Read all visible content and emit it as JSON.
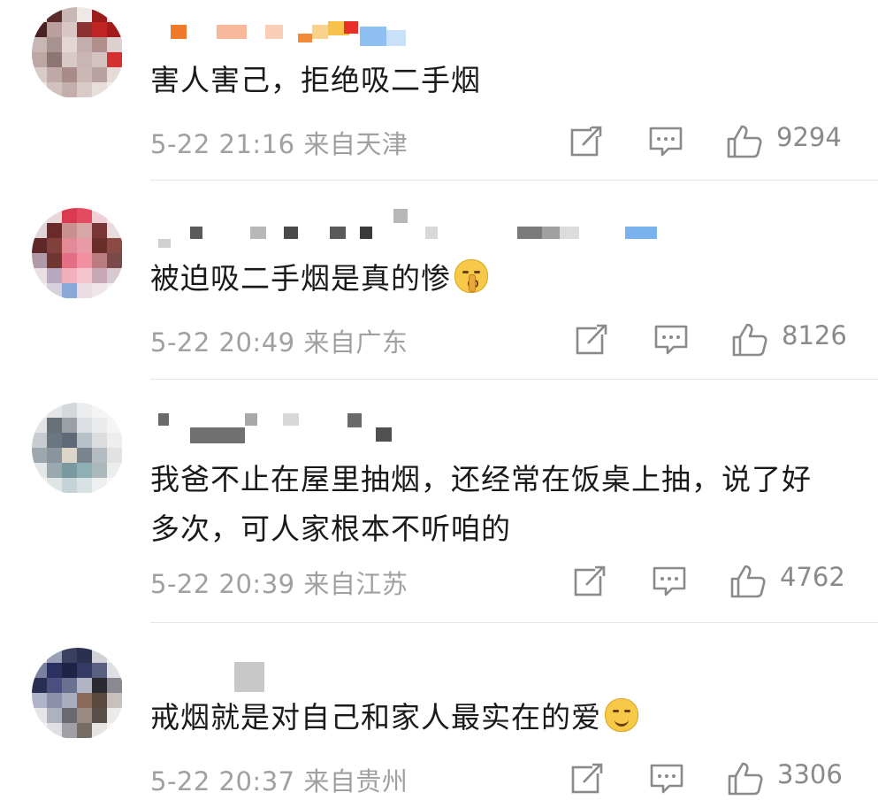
{
  "comments": [
    {
      "text": "害人害己，拒绝吸二手烟",
      "timestamp": "5-22 21:16",
      "location": "来自天津",
      "likes": "9294",
      "emoji": null
    },
    {
      "text": "被迫吸二手烟是真的惨",
      "timestamp": "5-22 20:49",
      "location": "来自广东",
      "likes": "8126",
      "emoji": "shushing-face-emoji"
    },
    {
      "text": "我爸不止在屋里抽烟，还经常在饭桌上抽，说了好多次，可人家根本不听咱的",
      "timestamp": "5-22 20:39",
      "location": "来自江苏",
      "likes": "4762",
      "emoji": null
    },
    {
      "text": "戒烟就是对自己和家人最实在的爱",
      "timestamp": "5-22 20:37",
      "location": "来自贵州",
      "likes": "3306",
      "emoji": "smiling-face-emoji"
    }
  ],
  "icons": {
    "repost": "repost-icon",
    "comment": "comment-icon",
    "like": "thumbs-up-icon"
  },
  "colors": {
    "text": "#1a1a1a",
    "meta": "#a0a0a0",
    "icon": "#8a8a8a",
    "divider": "#e6e6e6"
  }
}
